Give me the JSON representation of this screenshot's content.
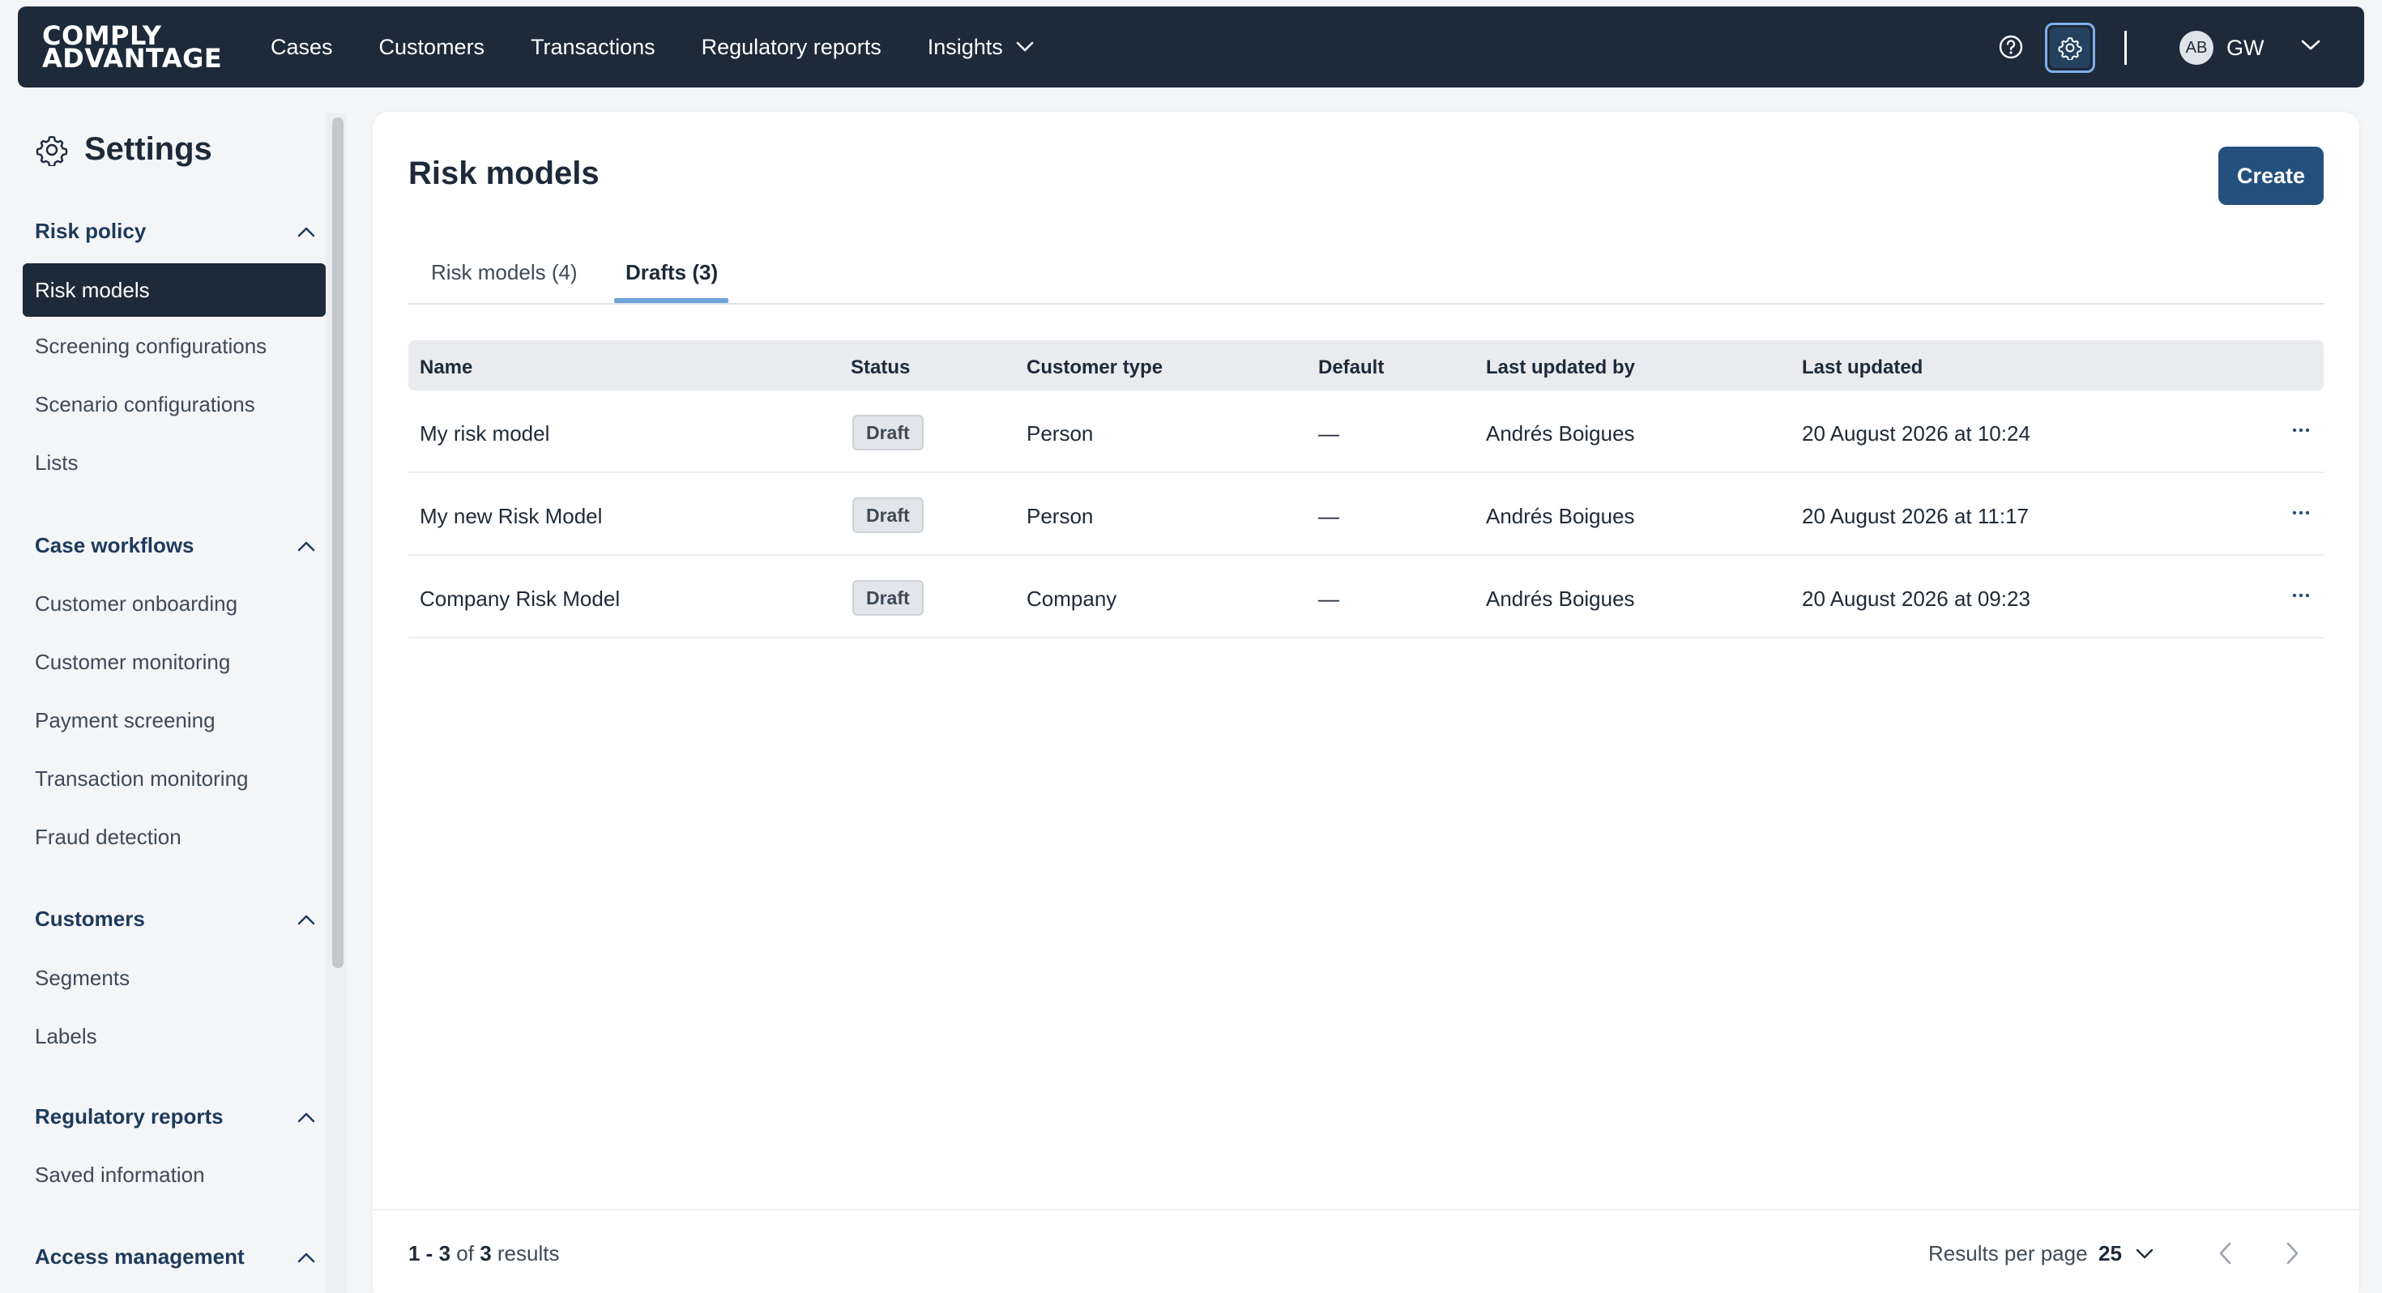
{
  "header": {
    "logo_line1": "COMPLY",
    "logo_line2": "ADVANTAGE",
    "nav": [
      "Cases",
      "Customers",
      "Transactions",
      "Regulatory reports",
      "Insights"
    ],
    "avatar_initials": "AB",
    "user_label": "GW",
    "icons": [
      "help-icon",
      "gear-icon",
      "chevron-down-icon"
    ]
  },
  "sidebar": {
    "title": "Settings",
    "sections": [
      {
        "label": "Risk policy",
        "items": [
          "Risk models",
          "Screening configurations",
          "Scenario configurations",
          "Lists"
        ]
      },
      {
        "label": "Case workflows",
        "items": [
          "Customer onboarding",
          "Customer monitoring",
          "Payment screening",
          "Transaction monitoring",
          "Fraud detection"
        ]
      },
      {
        "label": "Customers",
        "items": [
          "Segments",
          "Labels"
        ]
      },
      {
        "label": "Regulatory reports",
        "items": [
          "Saved information"
        ]
      },
      {
        "label": "Access management",
        "items": []
      }
    ],
    "active_item": "Risk models"
  },
  "main": {
    "title": "Risk models",
    "create_label": "Create",
    "tabs": [
      {
        "label": "Risk models (4)",
        "active": false
      },
      {
        "label": "Drafts (3)",
        "active": true
      }
    ],
    "columns": [
      "Name",
      "Status",
      "Customer type",
      "Default",
      "Last updated by",
      "Last updated"
    ],
    "rows": [
      {
        "name": "My risk model",
        "status": "Draft",
        "customer_type": "Person",
        "default": "—",
        "updated_by": "Andrés Boigues",
        "updated": "20 August 2026 at 10:24"
      },
      {
        "name": "My new Risk Model",
        "status": "Draft",
        "customer_type": "Person",
        "default": "—",
        "updated_by": "Andrés Boigues",
        "updated": "20 August 2026 at 11:17"
      },
      {
        "name": "Company Risk Model",
        "status": "Draft",
        "customer_type": "Company",
        "default": "—",
        "updated_by": "Andrés Boigues",
        "updated": "20 August 2026 at 09:23"
      }
    ]
  },
  "footer": {
    "range": "1 - 3",
    "of": "of",
    "total": "3",
    "results": "results",
    "per_page_label": "Results per page",
    "per_page_value": "25"
  },
  "colors": {
    "header_bg": "#1d2a3a",
    "accent": "#24507e",
    "tab_underline": "#6ca3d8"
  }
}
